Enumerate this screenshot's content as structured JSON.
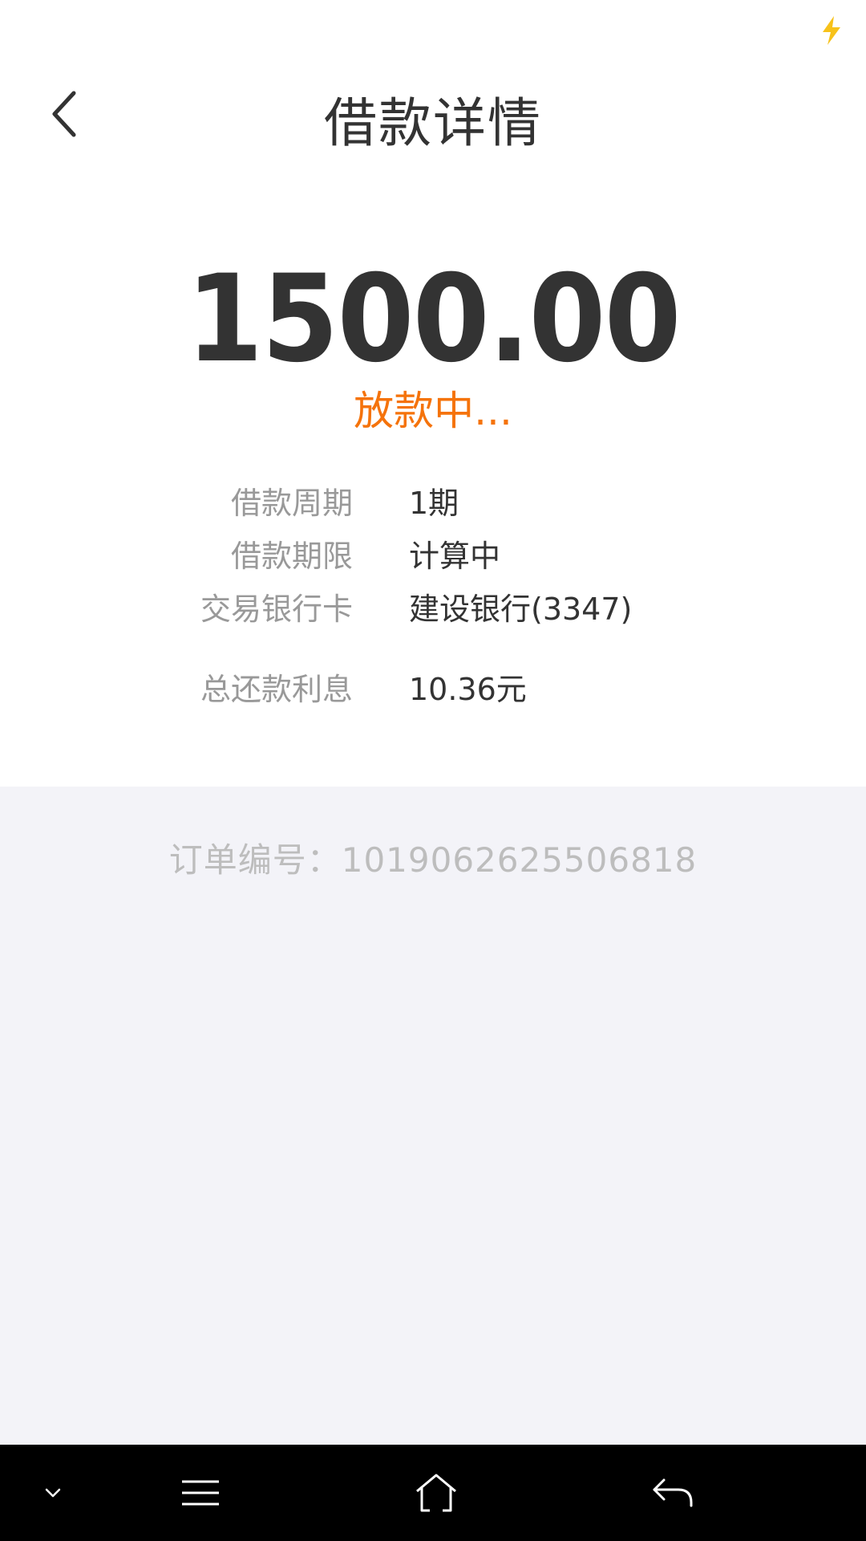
{
  "header": {
    "title": "借款详情"
  },
  "loan": {
    "amount": "1500.00",
    "status": "放款中...",
    "status_color": "#f5730b"
  },
  "details": [
    {
      "label": "借款周期",
      "value": "1期"
    },
    {
      "label": "借款期限",
      "value": "计算中"
    },
    {
      "label": "交易银行卡",
      "value": "建设银行(3347)"
    },
    {
      "label": "总还款利息",
      "value": "10.36元"
    }
  ],
  "order": {
    "text": "订单编号：1019062625506818"
  },
  "icons": {
    "status_bar": "lightning-bolt-icon",
    "back": "chevron-left-icon",
    "nav": [
      "chevron-down-icon",
      "menu-icon",
      "home-icon",
      "back-arrow-icon"
    ]
  },
  "colors": {
    "text_primary": "#333333",
    "text_secondary": "#999999",
    "text_muted": "#bdbdbd",
    "section_bg": "#f3f3f8",
    "accent": "#f5730b",
    "bolt": "#f7c21a"
  }
}
